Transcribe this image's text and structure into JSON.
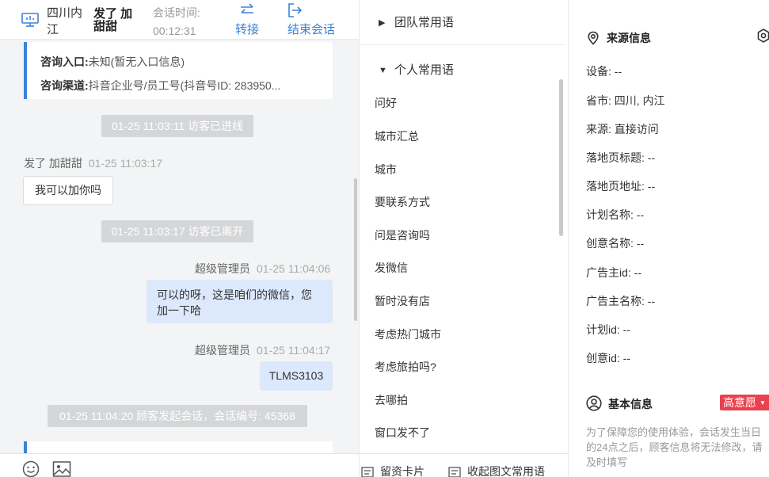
{
  "header": {
    "region": "四川内江",
    "visitor": "发了 加甜甜",
    "time_label": "会话时间:",
    "time_value": "00:12:31",
    "transfer": "转接",
    "end": "结束会话"
  },
  "info_card": {
    "entry_label": "咨询入口:",
    "entry_value": "未知(暂无入口信息)",
    "channel_label": "咨询渠道:",
    "channel_value": "抖音企业号/员工号(抖音号ID: 283950..."
  },
  "messages": {
    "sys1": "01-25 11:03:11 访客已进线",
    "visitor_name": "发了 加甜甜",
    "visitor_time": "01-25 11:03:17",
    "visitor_text": "我可以加你吗",
    "sys2": "01-25 11:03:17 访客已离开",
    "agent_name": "超级管理员",
    "agent_time1": "01-25 11:04:06",
    "agent_text1": "可以的呀，这是咱们的微信，您加一下哈",
    "agent_time2": "01-25 11:04:17",
    "agent_text2": "TLMS3103",
    "sys3": "01-25 11:04:20 顾客发起会话，会话编号: 45368"
  },
  "phrases": {
    "team": "团队常用语",
    "personal": "个人常用语",
    "items": [
      "问好",
      "城市汇总",
      "城市",
      "要联系方式",
      "问是咨询吗",
      "发微信",
      "暂时没有店",
      "考虑热门城市",
      "考虑旅拍吗?",
      "去哪拍",
      "窗口发不了"
    ],
    "card_btn": "留资卡片",
    "collapse_btn": "收起图文常用语"
  },
  "source_info": {
    "title": "来源信息",
    "fields": [
      "设备: --",
      "省市: 四川, 内江",
      "来源: 直接访问",
      "落地页标题: --",
      "落地页地址: --",
      "计划名称: --",
      "创意名称: --",
      "广告主id: --",
      "广告主名称: --",
      "计划id: --",
      "创意id: --"
    ]
  },
  "basic_info": {
    "title": "基本信息",
    "intent": "高意愿",
    "note": "为了保障您的使用体验，会话发生当日的24点之后，顾客信息将无法修改，请及时填写"
  },
  "colors": {
    "accent": "#3b82d9",
    "badge": "#e8414f",
    "agent_bubble": "#dce8fb"
  }
}
